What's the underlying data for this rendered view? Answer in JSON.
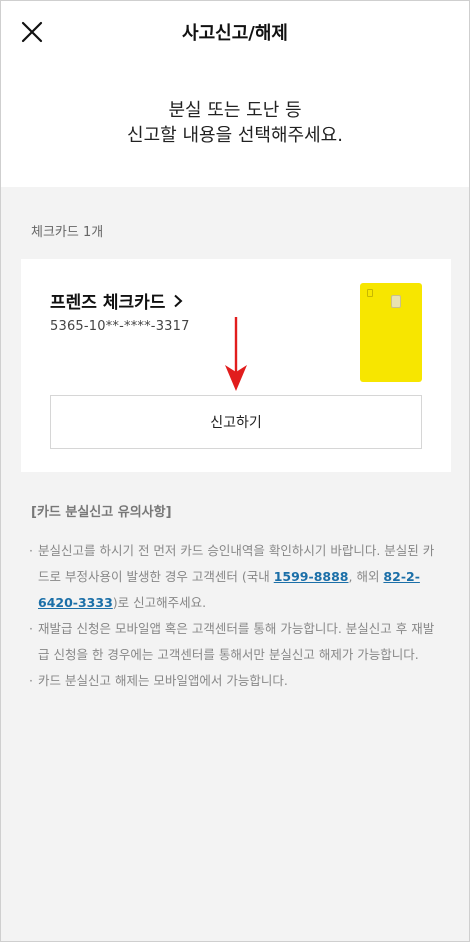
{
  "header": {
    "title": "사고신고/해제",
    "close_icon": "close-icon"
  },
  "intro": {
    "line1": "분실 또는 도난 등",
    "line2": "신고할 내용을 선택해주세요."
  },
  "card_section": {
    "label": "체크카드 1개",
    "card": {
      "name": "프렌즈 체크카드",
      "number": "5365-10**-****-3317",
      "color": "#f7e600",
      "report_button": "신고하기"
    }
  },
  "notice": {
    "title": "[카드 분실신고 유의사항]",
    "item1_a": "분실신고를 하시기 전 먼저 카드 승인내역을 확인하시기 바랍니다. 분실된 카드로 부정사용이 발생한 경우 고객센터 (국내 ",
    "item1_phone_domestic": "1599-8888",
    "item1_b": ", 해외 ",
    "item1_phone_overseas": "82-2-6420-3333",
    "item1_c": ")로 신고해주세요.",
    "item2": "재발급 신청은 모바일앱 혹은 고객센터를 통해 가능합니다. 분실신고 후 재발급 신청을 한 경우에는 고객센터를 통해서만 분실신고 해제가 가능합니다.",
    "item3": "카드 분실신고 해제는 모바일앱에서 가능합니다."
  },
  "colors": {
    "link": "#1b6fa8",
    "arrow": "#e11d1d",
    "background": "#f3f3f3"
  }
}
